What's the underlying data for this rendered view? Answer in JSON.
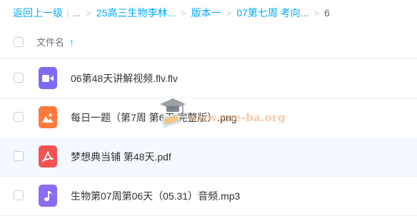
{
  "breadcrumb": {
    "back_label": "返回上一级",
    "ellipsis": "...",
    "separator": ">",
    "items": [
      "25高三生物李林...",
      "版本一",
      "07第七周 考向..."
    ],
    "current": "6"
  },
  "list_header": {
    "column_name": "文件名",
    "sort_icon": "arrow-up-icon"
  },
  "files": [
    {
      "name": "06第48天讲解视频.flv.flv",
      "icon": "video-icon",
      "color": "#7c6cf5"
    },
    {
      "name": "每日一题（第7周 第6天 完整版）.png",
      "icon": "image-icon",
      "color": "#ff7a3d"
    },
    {
      "name": "梦想典当铺 第48天.pdf",
      "icon": "pdf-icon",
      "color": "#f25252"
    },
    {
      "name": "生物第07周第06天（05.31）音频.mp3",
      "icon": "music-icon",
      "color": "#8b6cf2"
    }
  ],
  "watermark": {
    "text": "www.yue-ba.org",
    "icon": "graduation-cap-icon"
  },
  "colors": {
    "accent": "#06a7ff",
    "row_hover": "#f4f9ff",
    "divider": "#eef0f3"
  }
}
